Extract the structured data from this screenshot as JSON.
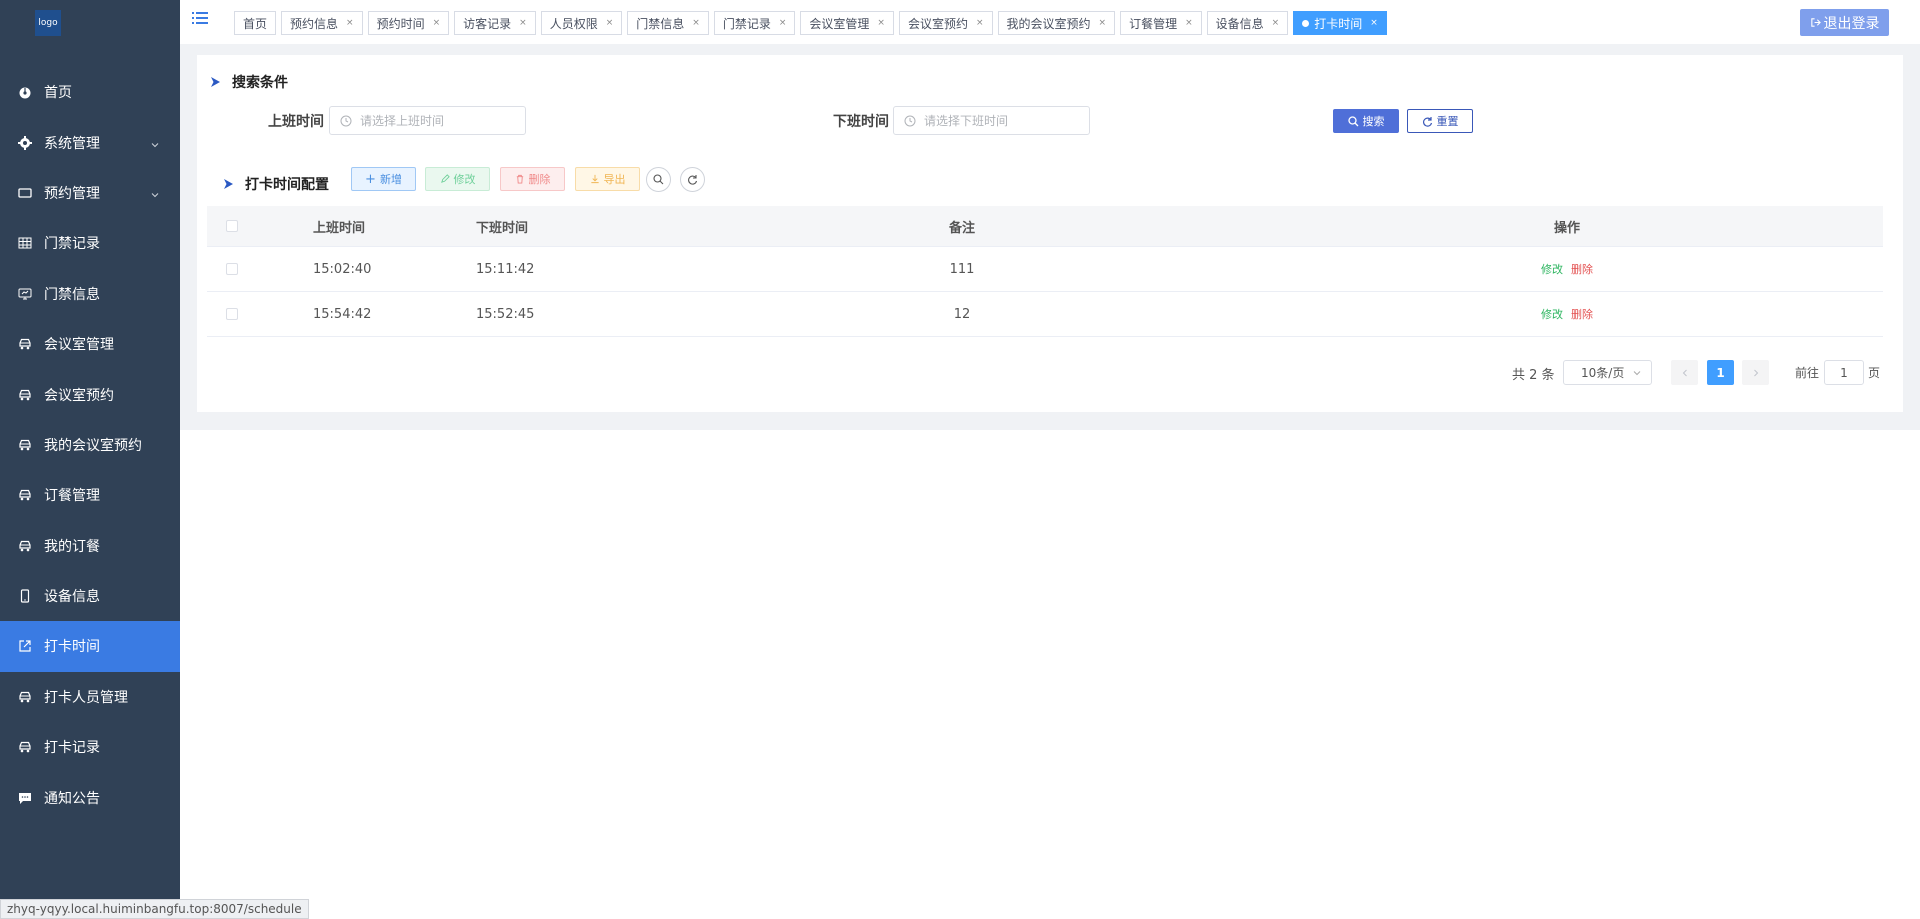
{
  "logo": "logo",
  "sidebar": {
    "items": [
      {
        "label": "首页",
        "icon": "dashboard-icon",
        "has_children": false,
        "active": false
      },
      {
        "label": "系统管理",
        "icon": "gear-icon",
        "has_children": true,
        "active": false
      },
      {
        "label": "预约管理",
        "icon": "monitor-icon",
        "has_children": true,
        "active": false
      },
      {
        "label": "门禁记录",
        "icon": "table-icon",
        "has_children": false,
        "active": false
      },
      {
        "label": "门禁信息",
        "icon": "screen-icon",
        "has_children": false,
        "active": false
      },
      {
        "label": "会议室管理",
        "icon": "car-icon",
        "has_children": false,
        "active": false
      },
      {
        "label": "会议室预约",
        "icon": "car-icon",
        "has_children": false,
        "active": false
      },
      {
        "label": "我的会议室预约",
        "icon": "car-icon",
        "has_children": false,
        "active": false
      },
      {
        "label": "订餐管理",
        "icon": "car-icon",
        "has_children": false,
        "active": false
      },
      {
        "label": "我的订餐",
        "icon": "car-icon",
        "has_children": false,
        "active": false
      },
      {
        "label": "设备信息",
        "icon": "phone-icon",
        "has_children": false,
        "active": false
      },
      {
        "label": "打卡时间",
        "icon": "external-link-icon",
        "has_children": false,
        "active": true
      },
      {
        "label": "打卡人员管理",
        "icon": "car-icon",
        "has_children": false,
        "active": false
      },
      {
        "label": "打卡记录",
        "icon": "car-icon",
        "has_children": false,
        "active": false
      },
      {
        "label": "通知公告",
        "icon": "message-icon",
        "has_children": false,
        "active": false
      }
    ]
  },
  "tags": [
    {
      "label": "首页",
      "closable": false,
      "active": false
    },
    {
      "label": "预约信息",
      "closable": true,
      "active": false
    },
    {
      "label": "预约时间",
      "closable": true,
      "active": false
    },
    {
      "label": "访客记录",
      "closable": true,
      "active": false
    },
    {
      "label": "人员权限",
      "closable": true,
      "active": false
    },
    {
      "label": "门禁信息",
      "closable": true,
      "active": false
    },
    {
      "label": "门禁记录",
      "closable": true,
      "active": false
    },
    {
      "label": "会议室管理",
      "closable": true,
      "active": false
    },
    {
      "label": "会议室预约",
      "closable": true,
      "active": false
    },
    {
      "label": "我的会议室预约",
      "closable": true,
      "active": false
    },
    {
      "label": "订餐管理",
      "closable": true,
      "active": false
    },
    {
      "label": "设备信息",
      "closable": true,
      "active": false
    },
    {
      "label": "打卡时间",
      "closable": true,
      "active": true
    }
  ],
  "header": {
    "logout_label": "退出登录"
  },
  "search": {
    "title": "搜索条件",
    "start_label": "上班时间",
    "start_placeholder": "请选择上班时间",
    "end_label": "下班时间",
    "end_placeholder": "请选择下班时间",
    "search_button": "搜索",
    "reset_button": "重置"
  },
  "config": {
    "title": "打卡时间配置",
    "add_button": "新增",
    "edit_button": "修改",
    "delete_button": "删除",
    "export_button": "导出"
  },
  "table": {
    "headers": [
      "上班时间",
      "下班时间",
      "备注",
      "操作"
    ],
    "rows": [
      {
        "start": "15:02:40",
        "end": "15:11:42",
        "note": "111",
        "edit": "修改",
        "delete": "删除"
      },
      {
        "start": "15:54:42",
        "end": "15:52:45",
        "note": "12",
        "edit": "修改",
        "delete": "删除"
      }
    ]
  },
  "pagination": {
    "total_text": "共 2 条",
    "page_size": "10条/页",
    "current_page": "1",
    "goto_label": "前往",
    "goto_value": "1",
    "goto_suffix": "页"
  },
  "statusbar": {
    "url": "zhyq-yqyy.local.huiminbangfu.top:8007/schedule"
  },
  "colors": {
    "sidebar_bg": "#304156",
    "active": "#3a7be3",
    "primary": "#409eff"
  }
}
